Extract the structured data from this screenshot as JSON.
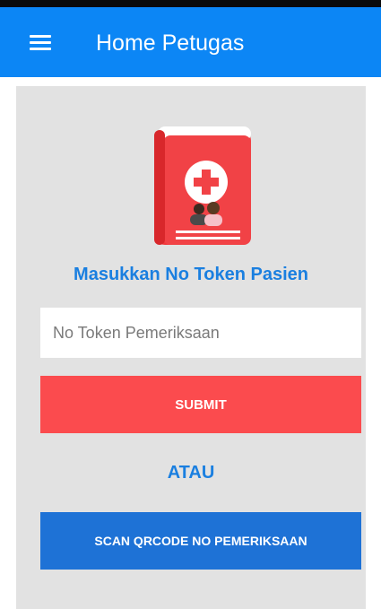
{
  "app_bar": {
    "title": "Home Petugas",
    "menu_icon": "hamburger-menu-icon",
    "color": "#0c86f5"
  },
  "logo": {
    "icon": "medical-record-book-icon",
    "color": "#f2373b"
  },
  "form": {
    "prompt": "Masukkan No Token Pasien",
    "token_placeholder": "No Token Pemeriksaan",
    "token_value": "",
    "submit_label": "SUBMIT",
    "or_label": "ATAU",
    "scan_label": "SCAN QRCODE NO PEMERIKSAAN"
  },
  "colors": {
    "accent_text": "#1a7fe0",
    "submit": "#fb4b4e",
    "scan": "#1e72d6",
    "panel": "#e2e2e2"
  }
}
